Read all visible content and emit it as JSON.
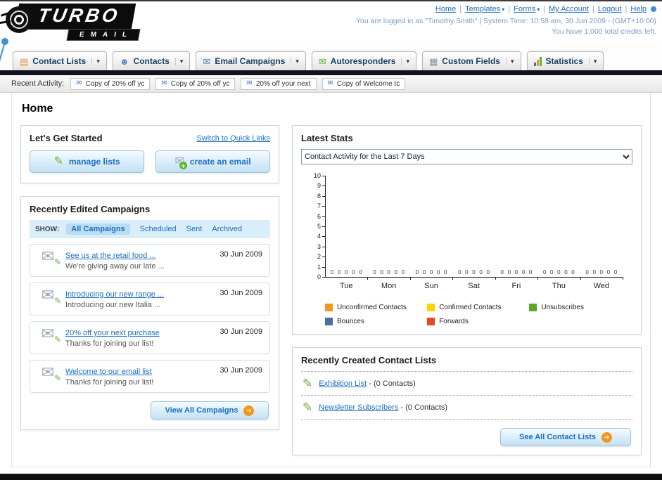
{
  "colors": {
    "accent_blue": "#1a6fc4",
    "dark_bar": "#13131d",
    "panel_border": "#c9d3dc",
    "orange": "#f7941d"
  },
  "icons": {
    "contact-lists-icon": {
      "glyph": "▤",
      "color": "#e09a3e"
    },
    "contacts-icon": {
      "glyph": "☻",
      "color": "#5a87c5"
    },
    "email-campaigns-icon": {
      "glyph": "✉",
      "color": "#4a7ebb"
    },
    "autoresponders-icon": {
      "glyph": "✉",
      "color": "#5cb531"
    },
    "custom-fields-icon": {
      "glyph": "▦",
      "color": "#8a97a5"
    },
    "statistics-icon": {
      "type": "bars",
      "colors": [
        "#4a6e9e",
        "#f7941d",
        "#5cb531"
      ]
    },
    "activity-email-icon": {
      "glyph": "✉",
      "color": "#4a7ebb"
    },
    "manage-lists-icon": {
      "glyph": "✎",
      "color": "#6fae3e"
    },
    "create-email-icon": {
      "glyph": "✉",
      "color": "#9aa8b5",
      "overlay": "+",
      "overlay_color": "#ffffff",
      "overlay_bg": "#5cb531"
    },
    "edit-campaign-icon": {
      "glyph": "✉",
      "color": "#9aa8b5",
      "overlay": "✎",
      "overlay_color": "#6fae3e"
    },
    "edit-list-icon": {
      "glyph": "✎",
      "color": "#6fae3e"
    },
    "arrow-right-icon": {
      "glyph": "➔",
      "color": "#ffffff",
      "bg": "#f7941d"
    }
  },
  "header": {
    "logo": {
      "line1": "TURBO",
      "line2": "EMAIL"
    },
    "links": [
      "Home",
      "Templates",
      "Forms",
      "My Account",
      "Logout",
      "Help"
    ],
    "dropdown_links": [
      "Templates",
      "Forms"
    ],
    "session_line": "You are logged in as \"Timothy Smith\" | System Time: 10:58 am, 30 Jun 2009 - (GMT+10:00)",
    "credits_line": "You have 1,000 total credits left."
  },
  "nav_tabs": [
    {
      "label": "Contact Lists",
      "icon": "contact-lists-icon"
    },
    {
      "label": "Contacts",
      "icon": "contacts-icon"
    },
    {
      "label": "Email Campaigns",
      "icon": "email-campaigns-icon"
    },
    {
      "label": "Autoresponders",
      "icon": "autoresponders-icon"
    },
    {
      "label": "Custom Fields",
      "icon": "custom-fields-icon"
    },
    {
      "label": "Statistics",
      "icon": "statistics-icon"
    }
  ],
  "recent_activity": {
    "label": "Recent Activity:",
    "items": [
      "Copy of 20% off yc",
      "Copy of 20% off yc",
      "20% off your next",
      "Copy of Welcome tc"
    ]
  },
  "page": {
    "title": "Home"
  },
  "get_started": {
    "title": "Let's Get Started",
    "switch_link": "Switch to Quick Links",
    "manage_lists_label": "manage lists",
    "create_email_label": "create an email"
  },
  "campaigns": {
    "title": "Recently Edited Campaigns",
    "show_label": "SHOW:",
    "filters": [
      {
        "label": "All Campaigns",
        "selected": true
      },
      {
        "label": "Scheduled",
        "selected": false
      },
      {
        "label": "Sent",
        "selected": false
      },
      {
        "label": "Archived",
        "selected": false
      }
    ],
    "items": [
      {
        "title": "See us at the retail food ...",
        "subtitle": "We're giving away our late ...",
        "date": "30 Jun 2009"
      },
      {
        "title": "Introducing our new range ...",
        "subtitle": "Introducing our new Italia ...",
        "date": "30 Jun 2009"
      },
      {
        "title": "20% off your next purchase",
        "subtitle": "Thanks for joining our list!",
        "date": "30 Jun 2009"
      },
      {
        "title": "Welcome to our email list",
        "subtitle": "Thanks for joining our list!",
        "date": "30 Jun 2009"
      }
    ],
    "view_all_label": "View All Campaigns"
  },
  "latest_stats": {
    "title": "Latest Stats",
    "selector_value": "Contact Activity for the Last 7 Days"
  },
  "chart_data": {
    "type": "bar",
    "title": "Contact Activity for the Last 7 Days",
    "categories": [
      "Tue",
      "Mon",
      "Sun",
      "Sat",
      "Fri",
      "Thu",
      "Wed"
    ],
    "series": [
      {
        "name": "Unconfirmed Contacts",
        "color": "#f7941d",
        "values": [
          0,
          0,
          0,
          0,
          0,
          0,
          0
        ]
      },
      {
        "name": "Confirmed Contacts",
        "color": "#ffd200",
        "values": [
          0,
          0,
          0,
          0,
          0,
          0,
          0
        ]
      },
      {
        "name": "Unsubscribes",
        "color": "#5ba829",
        "values": [
          0,
          0,
          0,
          0,
          0,
          0,
          0
        ]
      },
      {
        "name": "Bounces",
        "color": "#4a6e9e",
        "values": [
          0,
          0,
          0,
          0,
          0,
          0,
          0
        ]
      },
      {
        "name": "Forwards",
        "color": "#e8481c",
        "values": [
          0,
          0,
          0,
          0,
          0,
          0,
          0
        ]
      }
    ],
    "ylim": [
      0,
      10
    ],
    "ytick_step": 1,
    "bar_value_labels": true,
    "grid": false,
    "legend_position": "bottom"
  },
  "contact_lists": {
    "title": "Recently Created Contact Lists",
    "items": [
      {
        "name": "Exhibition List",
        "suffix": "- (0 Contacts)"
      },
      {
        "name": "Newsletter Subscribers",
        "suffix": "- (0 Contacts)"
      }
    ],
    "see_all_label": "See All Contact Lists"
  }
}
